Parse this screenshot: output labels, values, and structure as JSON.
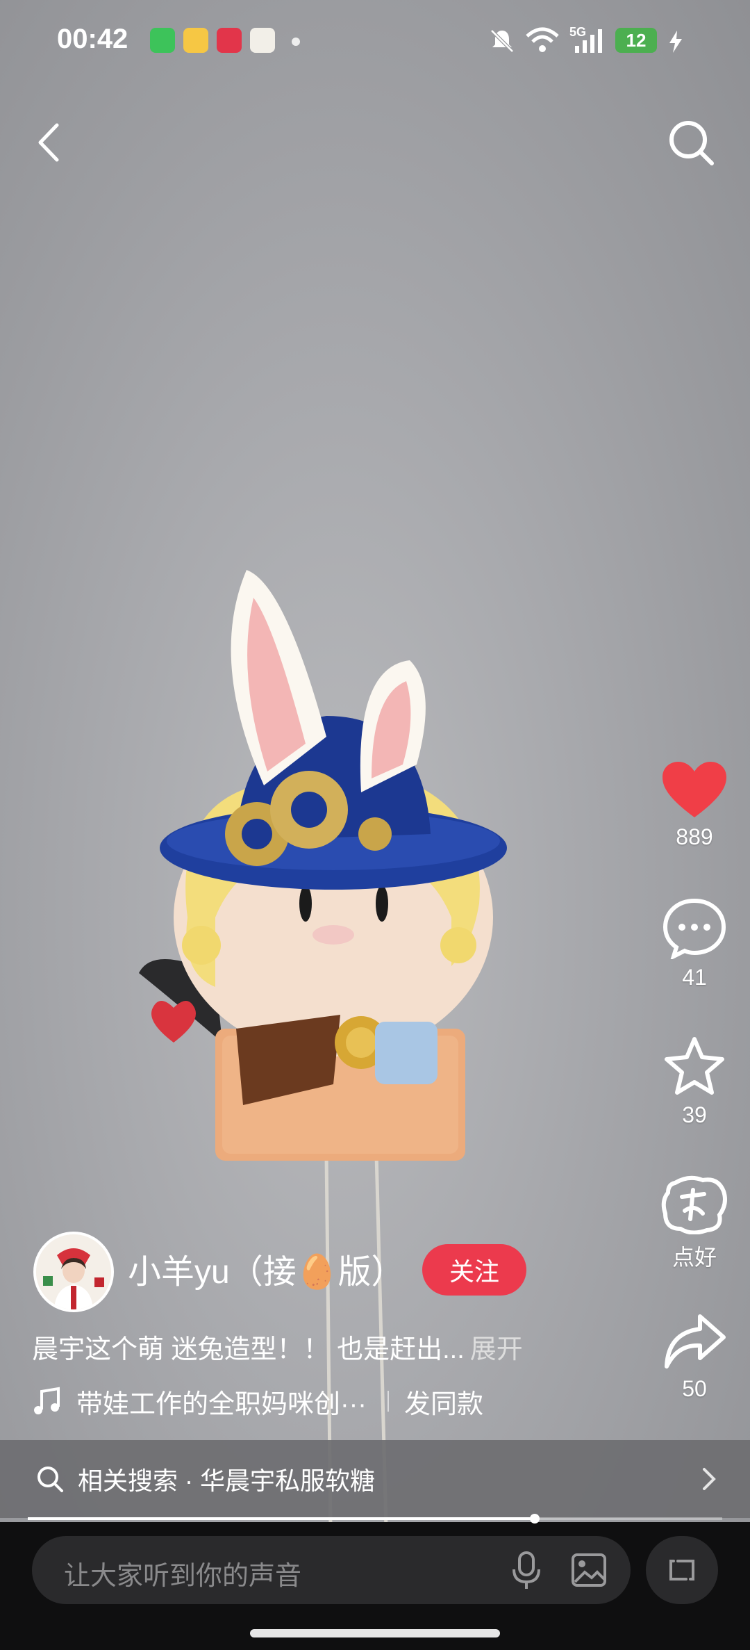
{
  "status_bar": {
    "time": "00:42",
    "network": "5G",
    "battery": "12"
  },
  "author": {
    "name": "小羊yu（接🥚版）",
    "follow_label": "关注"
  },
  "caption": {
    "text": "晨宇这个萌 迷兔造型！！ 也是赶出...",
    "more_label": "展开"
  },
  "music": {
    "title": "带娃工作的全职妈咪创···",
    "same_label": "发同款"
  },
  "actions": {
    "likes": "889",
    "comments": "41",
    "favorites": "39",
    "nice_label": "点好",
    "shares": "50"
  },
  "related_search": {
    "text": "相关搜索 · 华晨宇私服软糖"
  },
  "comment_input": {
    "placeholder": "让大家听到你的声音"
  },
  "progress": {
    "fraction": 0.73
  },
  "colors": {
    "like": "#f03e47",
    "follow": "#ec3a4d",
    "hat": "#1f3f9e"
  }
}
